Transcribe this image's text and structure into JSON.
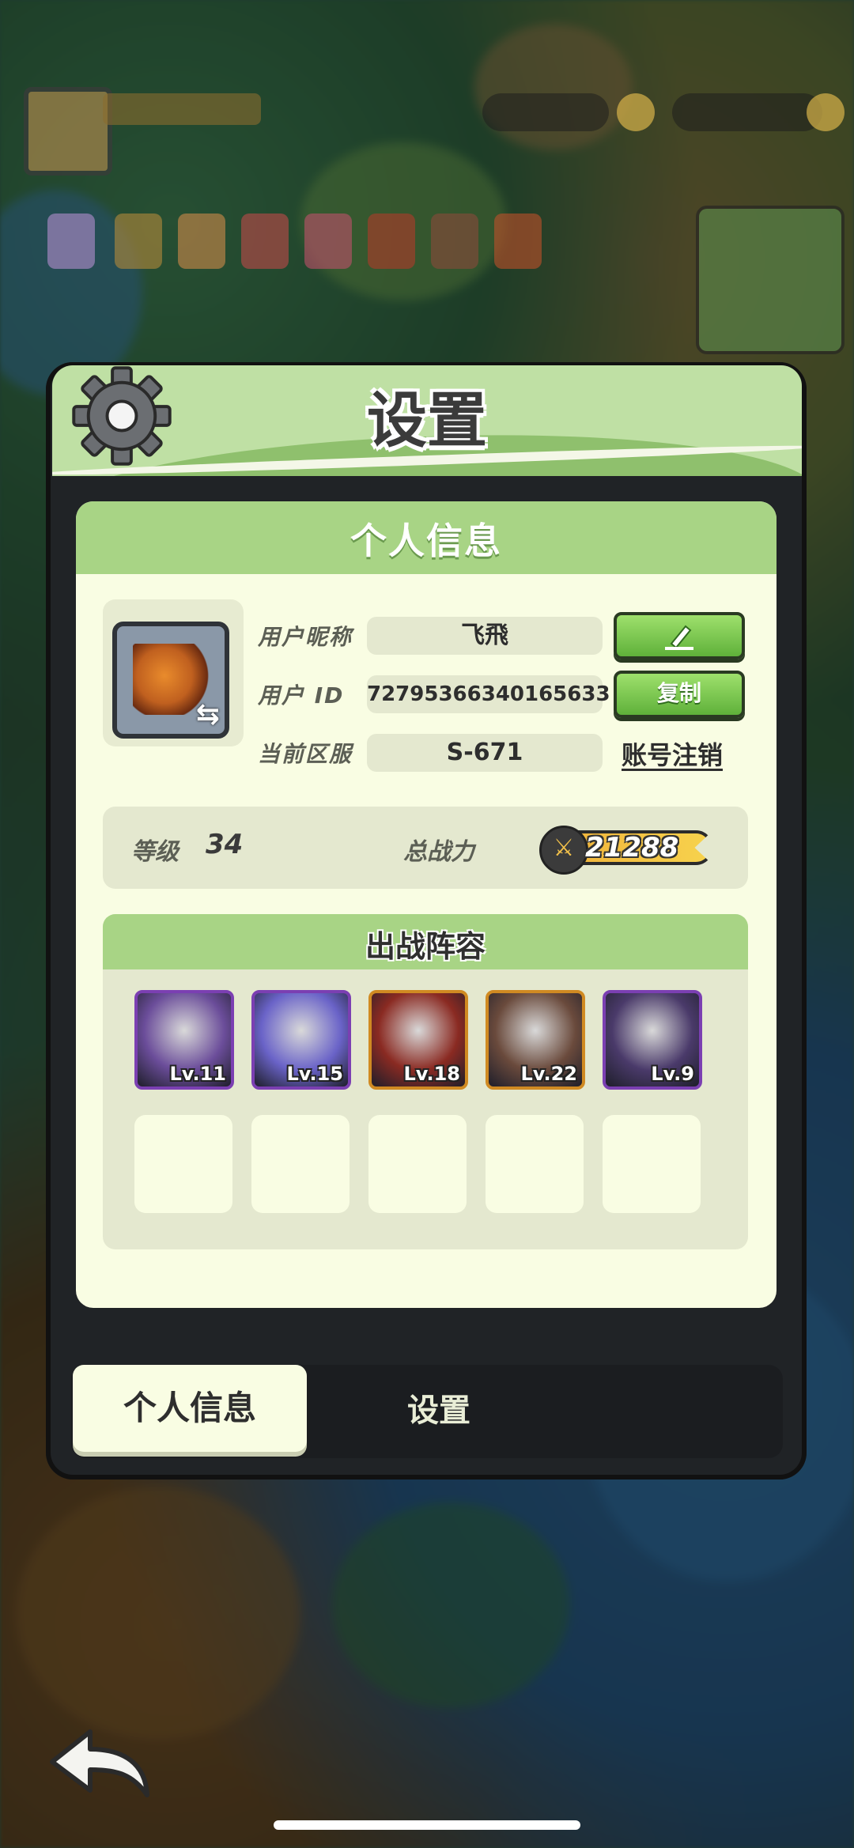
{
  "dialog": {
    "title": "设置"
  },
  "profile": {
    "section_title": "个人信息",
    "nickname_label": "用户昵称",
    "nickname_value": "飞飛",
    "id_label": "用户 ID",
    "id_value": "72795366340165633",
    "server_label": "当前区服",
    "server_value": "S-671",
    "copy_button": "复制",
    "deregister_link": "账号注销"
  },
  "stats": {
    "level_label": "等级",
    "level_value": "34",
    "power_label": "总战力",
    "power_value": "21288"
  },
  "lineup": {
    "title": "出战阵容",
    "heroes": [
      {
        "level": "Lv.11",
        "color": "#6b4d9a",
        "frame": "purple"
      },
      {
        "level": "Lv.15",
        "color": "#6a63c8",
        "frame": "purple"
      },
      {
        "level": "Lv.18",
        "color": "#8a2a22",
        "frame": "gold"
      },
      {
        "level": "Lv.22",
        "color": "#6a4a3c",
        "frame": "gold"
      },
      {
        "level": "Lv.9",
        "color": "#4a3a6a",
        "frame": "purple"
      }
    ]
  },
  "tabs": {
    "personal_info": "个人信息",
    "settings": "设置"
  },
  "icons": {
    "gear": "gear-icon",
    "edit": "pencil-icon",
    "power": "crossed-swords-icon",
    "back": "back-arrow-icon",
    "swap": "swap-arrows-icon"
  }
}
